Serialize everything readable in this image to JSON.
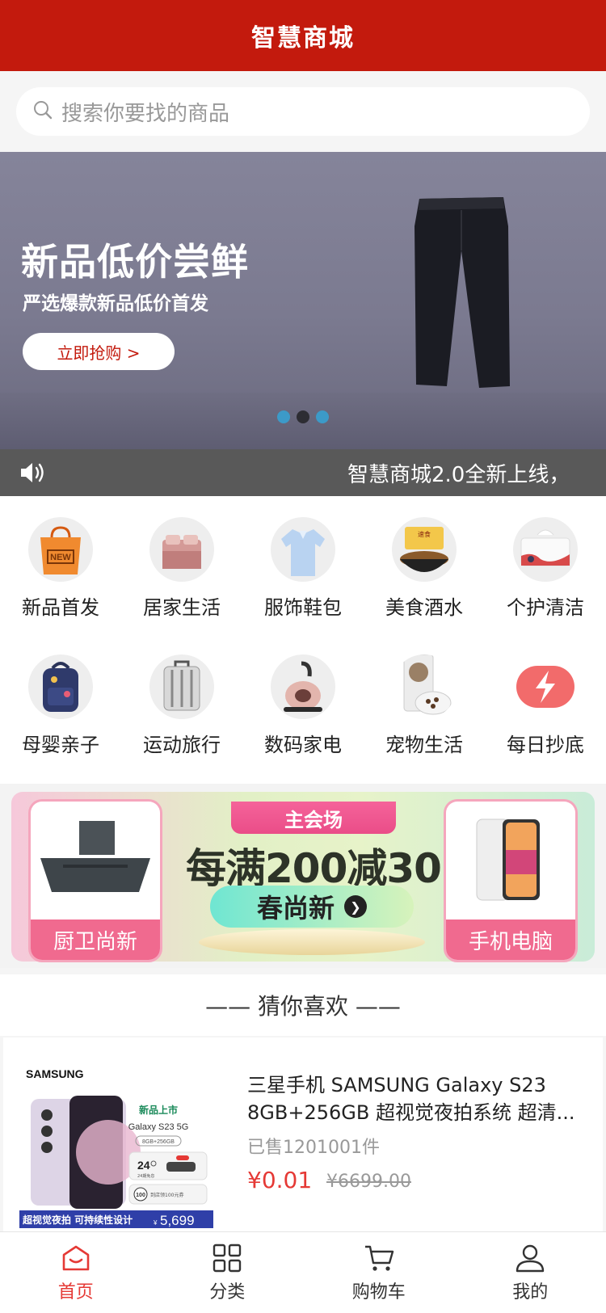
{
  "header": {
    "title": "智慧商城"
  },
  "search": {
    "placeholder": "搜索你要找的商品"
  },
  "banner": {
    "headline": "新品低价尝鲜",
    "subline": "严选爆款新品低价首发",
    "cta": "立即抢购 >",
    "slide_count": 3,
    "active_slide": 2
  },
  "notice": {
    "text": "智慧商城2.0全新上线，"
  },
  "categories": [
    {
      "label": "新品首发",
      "icon": "new-bag-icon"
    },
    {
      "label": "居家生活",
      "icon": "bed-icon"
    },
    {
      "label": "服饰鞋包",
      "icon": "shirt-icon"
    },
    {
      "label": "美食酒水",
      "icon": "noodle-bowl-icon"
    },
    {
      "label": "个护清洁",
      "icon": "tissue-icon"
    },
    {
      "label": "母婴亲子",
      "icon": "backpack-icon"
    },
    {
      "label": "运动旅行",
      "icon": "luggage-icon"
    },
    {
      "label": "数码家电",
      "icon": "vacuum-icon"
    },
    {
      "label": "宠物生活",
      "icon": "pet-food-icon"
    },
    {
      "label": "每日抄底",
      "icon": "lightning-icon"
    }
  ],
  "promo": {
    "tag": "主会场",
    "headline": "每满200减30",
    "sub": "春尚新",
    "left_label": "厨卫尚新",
    "right_label": "手机电脑"
  },
  "guess": {
    "title": "—— 猜你喜欢 ——"
  },
  "product": {
    "name": "三星手机 SAMSUNG Galaxy S23 8GB+256GB 超视觉夜拍系统 超清...",
    "sold": "已售1201001件",
    "price": "¥0.01",
    "original_price": "¥6699.00",
    "image": {
      "brand": "SAMSUNG",
      "badge": "新品上市",
      "model": "Galaxy S23 5G",
      "spec": "8GB+256GB",
      "footer": "超视觉夜拍 可持续性设计",
      "footer_price": "5,699",
      "currency": "¥",
      "interest_free": "24",
      "interest_free_note": "24期免息",
      "trade_in_amount": "100",
      "trade_in_note": "到店领100元券"
    }
  },
  "tabbar": [
    {
      "label": "首页",
      "icon": "home-icon",
      "active": true
    },
    {
      "label": "分类",
      "icon": "grid-icon",
      "active": false
    },
    {
      "label": "购物车",
      "icon": "cart-icon",
      "active": false
    },
    {
      "label": "我的",
      "icon": "user-icon",
      "active": false
    }
  ],
  "colors": {
    "brand": "#c31a0d",
    "price": "#e53935",
    "notice_bg": "#595959"
  }
}
